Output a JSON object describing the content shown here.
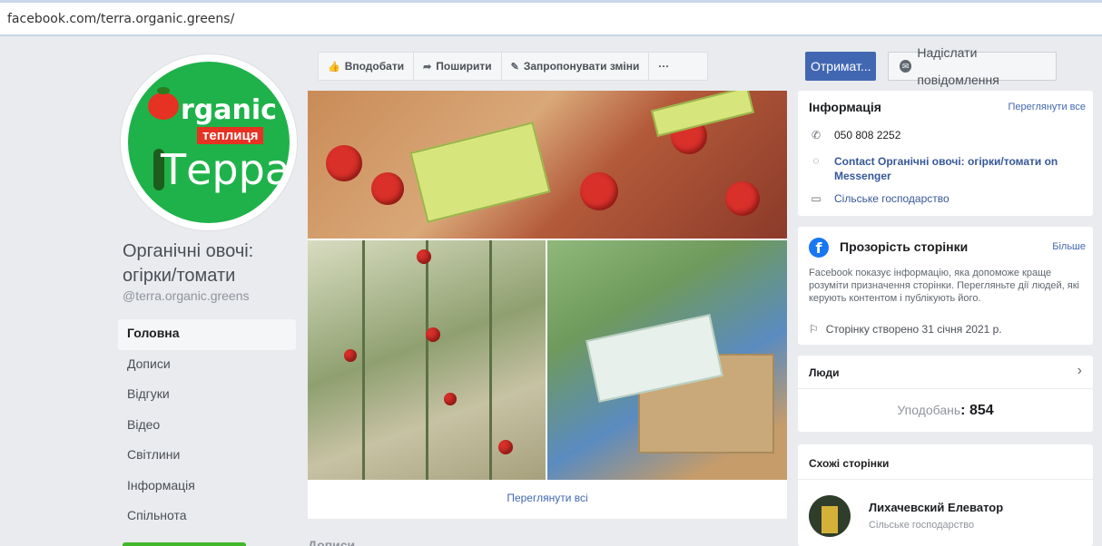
{
  "browser": {
    "url": "facebook.com/terra.organic.greens/"
  },
  "page": {
    "logo": {
      "word": "rganic",
      "tag": "теплиця",
      "brand": "Терра"
    },
    "name": "Органічні овочі: огірки/томати",
    "handle": "@terra.organic.greens"
  },
  "leftnav": {
    "items": [
      {
        "label": "Головна"
      },
      {
        "label": "Дописи"
      },
      {
        "label": "Відгуки"
      },
      {
        "label": "Відео"
      },
      {
        "label": "Світлини"
      },
      {
        "label": "Інформація"
      },
      {
        "label": "Спільнота"
      }
    ]
  },
  "actions": {
    "like": "Вподобати",
    "share": "Поширити",
    "suggest": "Запропонувати зміни",
    "more": "···"
  },
  "photos": {
    "view_all": "Переглянути всі"
  },
  "posts": {
    "heading": "Дописи"
  },
  "buttons": {
    "get": "Отримат...",
    "message": "Надіслати повідомлення"
  },
  "info": {
    "title": "Інформація",
    "view_all": "Переглянути все",
    "phone": "050 808 2252",
    "messenger": "Contact Органічні овочі: огірки/томати on Messenger",
    "category": "Сільське господарство"
  },
  "transparency": {
    "title": "Прозорість сторінки",
    "more": "Більше",
    "description": "Facebook показує інформацію, яка допоможе краще розуміти призначення сторінки. Перегляньте дії людей, які керують контентом і публікують його.",
    "created": "Сторінку створено 31 січня 2021 р."
  },
  "people": {
    "title": "Люди",
    "likes_label": "Уподобань",
    "likes_sep": ": ",
    "likes_count": "854"
  },
  "similar": {
    "title": "Схожі сторінки",
    "items": [
      {
        "name": "Лихачевский Елеватор",
        "category": "Сільське господарство"
      }
    ]
  },
  "colors": {
    "accent": "#4267b2",
    "logo_green": "#1fb24a",
    "logo_red": "#e63222"
  }
}
